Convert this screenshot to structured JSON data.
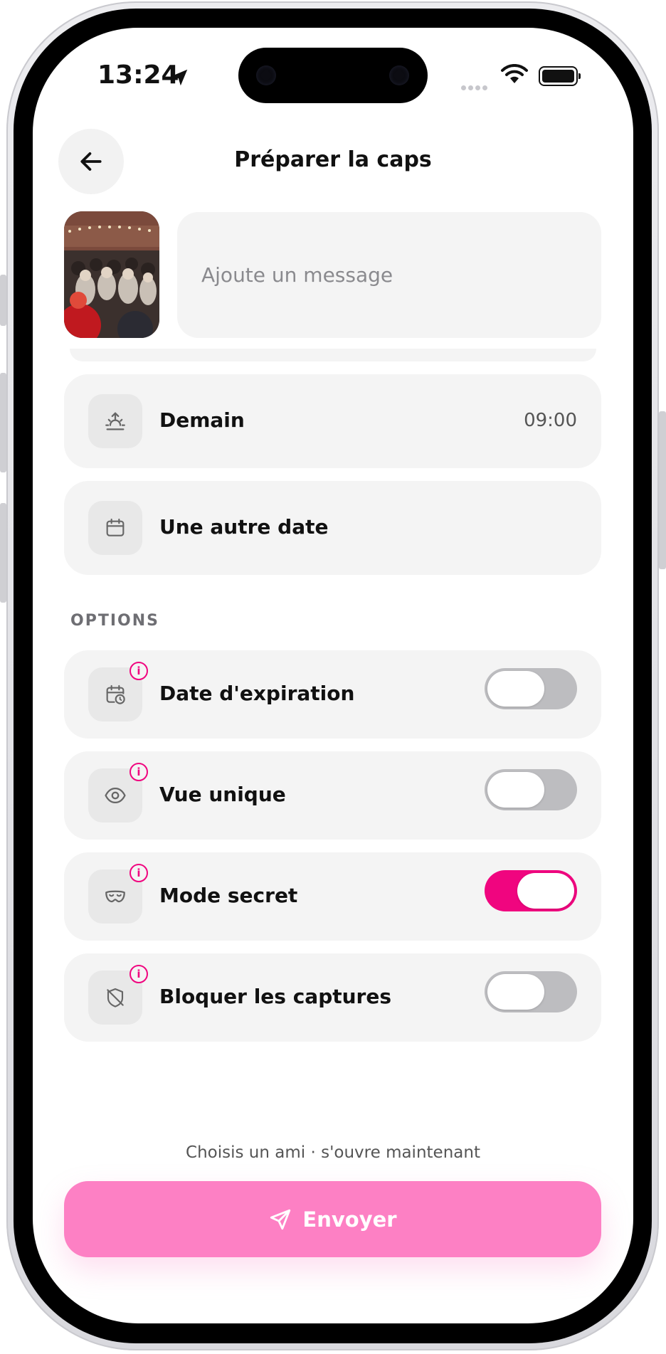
{
  "status_bar": {
    "time": "13:24"
  },
  "header": {
    "title": "Préparer la caps"
  },
  "message": {
    "placeholder": "Ajoute un message"
  },
  "schedule": [
    {
      "label": "Demain",
      "value": "09:00",
      "icon": "sunrise-icon"
    },
    {
      "label": "Une autre date",
      "value": "",
      "icon": "calendar-icon"
    }
  ],
  "options": {
    "heading": "OPTIONS",
    "items": [
      {
        "label": "Date d'expiration",
        "icon": "calendar-clock-icon",
        "enabled": false
      },
      {
        "label": "Vue unique",
        "icon": "eye-icon",
        "enabled": false
      },
      {
        "label": "Mode secret",
        "icon": "mask-icon",
        "enabled": true
      },
      {
        "label": "Bloquer les captures",
        "icon": "shield-off-icon",
        "enabled": false
      }
    ]
  },
  "footer": {
    "hint": "Choisis un ami · s'ouvre maintenant",
    "send_label": "Envoyer"
  },
  "colors": {
    "accent": "#f0057f",
    "send_button": "#fd80c4",
    "row_bg": "#f4f4f4"
  }
}
